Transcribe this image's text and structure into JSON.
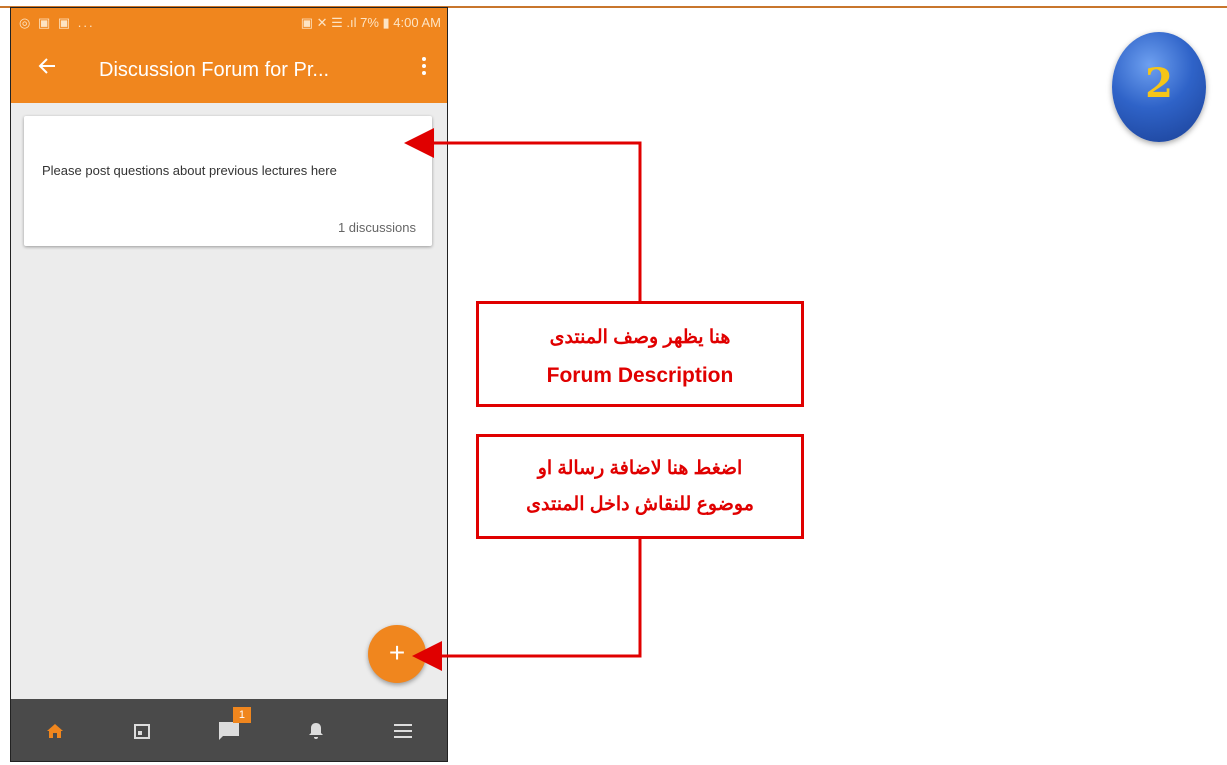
{
  "status_bar": {
    "left_icons": "◎ ▣ ▣ ...",
    "right_text": "▣ ✕ ☰ .ıl 7% ▮ 4:00 AM"
  },
  "toolbar": {
    "back_icon": "arrow-back-icon",
    "title": "Discussion Forum for Pr...",
    "menu_icon": "more-vert-icon"
  },
  "forum_card": {
    "description": "Please post questions about previous lectures here",
    "discussion_count": "1 discussions"
  },
  "fab": {
    "label": "+"
  },
  "bottom_nav": {
    "items": [
      {
        "icon": "home-icon"
      },
      {
        "icon": "calendar-icon"
      },
      {
        "icon": "messages-icon",
        "badge": "1"
      },
      {
        "icon": "bell-icon"
      },
      {
        "icon": "menu-icon"
      }
    ]
  },
  "annotations": {
    "callout_description": {
      "arabic": "هنا يظهر وصف المنتدى",
      "english": "Forum Description"
    },
    "callout_add": {
      "line1": "اضغط هنا لاضافة رسالة او",
      "line2": "موضوع للنقاش داخل المنتدى"
    },
    "step_number": "2"
  },
  "colors": {
    "accent": "#f0861e",
    "annotation_red": "#e00000",
    "nav_bg": "#4a4a4a"
  }
}
